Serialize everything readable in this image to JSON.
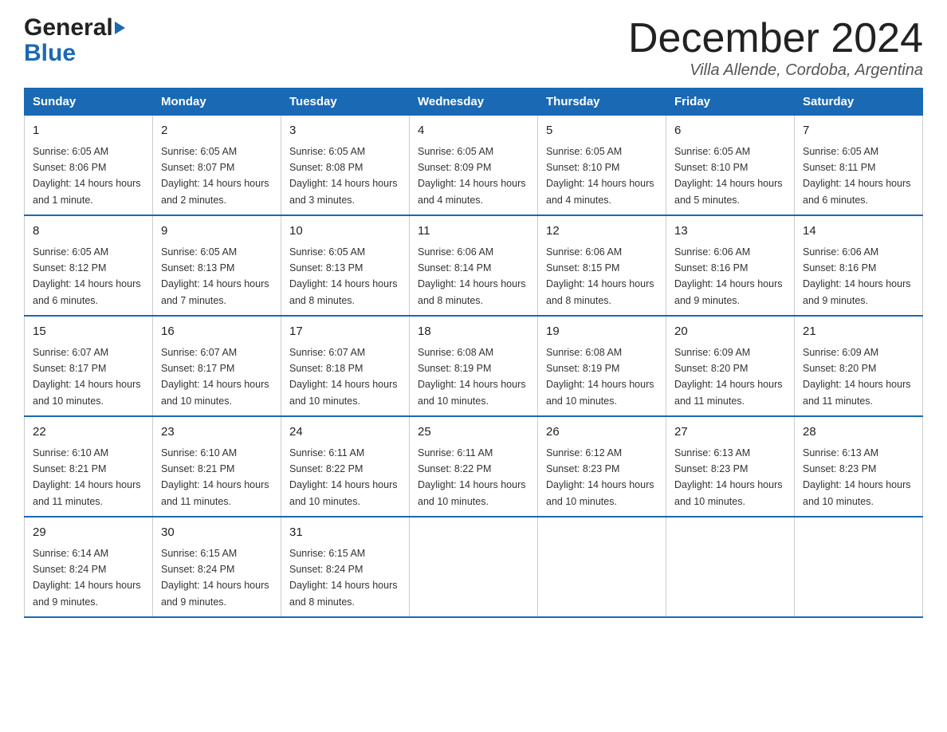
{
  "header": {
    "logo_general": "General",
    "logo_blue": "Blue",
    "title": "December 2024",
    "subtitle": "Villa Allende, Cordoba, Argentina"
  },
  "days_of_week": [
    "Sunday",
    "Monday",
    "Tuesday",
    "Wednesday",
    "Thursday",
    "Friday",
    "Saturday"
  ],
  "weeks": [
    [
      {
        "day": "1",
        "sunrise": "6:05 AM",
        "sunset": "8:06 PM",
        "daylight": "14 hours and 1 minute."
      },
      {
        "day": "2",
        "sunrise": "6:05 AM",
        "sunset": "8:07 PM",
        "daylight": "14 hours and 2 minutes."
      },
      {
        "day": "3",
        "sunrise": "6:05 AM",
        "sunset": "8:08 PM",
        "daylight": "14 hours and 3 minutes."
      },
      {
        "day": "4",
        "sunrise": "6:05 AM",
        "sunset": "8:09 PM",
        "daylight": "14 hours and 4 minutes."
      },
      {
        "day": "5",
        "sunrise": "6:05 AM",
        "sunset": "8:10 PM",
        "daylight": "14 hours and 4 minutes."
      },
      {
        "day": "6",
        "sunrise": "6:05 AM",
        "sunset": "8:10 PM",
        "daylight": "14 hours and 5 minutes."
      },
      {
        "day": "7",
        "sunrise": "6:05 AM",
        "sunset": "8:11 PM",
        "daylight": "14 hours and 6 minutes."
      }
    ],
    [
      {
        "day": "8",
        "sunrise": "6:05 AM",
        "sunset": "8:12 PM",
        "daylight": "14 hours and 6 minutes."
      },
      {
        "day": "9",
        "sunrise": "6:05 AM",
        "sunset": "8:13 PM",
        "daylight": "14 hours and 7 minutes."
      },
      {
        "day": "10",
        "sunrise": "6:05 AM",
        "sunset": "8:13 PM",
        "daylight": "14 hours and 8 minutes."
      },
      {
        "day": "11",
        "sunrise": "6:06 AM",
        "sunset": "8:14 PM",
        "daylight": "14 hours and 8 minutes."
      },
      {
        "day": "12",
        "sunrise": "6:06 AM",
        "sunset": "8:15 PM",
        "daylight": "14 hours and 8 minutes."
      },
      {
        "day": "13",
        "sunrise": "6:06 AM",
        "sunset": "8:16 PM",
        "daylight": "14 hours and 9 minutes."
      },
      {
        "day": "14",
        "sunrise": "6:06 AM",
        "sunset": "8:16 PM",
        "daylight": "14 hours and 9 minutes."
      }
    ],
    [
      {
        "day": "15",
        "sunrise": "6:07 AM",
        "sunset": "8:17 PM",
        "daylight": "14 hours and 10 minutes."
      },
      {
        "day": "16",
        "sunrise": "6:07 AM",
        "sunset": "8:17 PM",
        "daylight": "14 hours and 10 minutes."
      },
      {
        "day": "17",
        "sunrise": "6:07 AM",
        "sunset": "8:18 PM",
        "daylight": "14 hours and 10 minutes."
      },
      {
        "day": "18",
        "sunrise": "6:08 AM",
        "sunset": "8:19 PM",
        "daylight": "14 hours and 10 minutes."
      },
      {
        "day": "19",
        "sunrise": "6:08 AM",
        "sunset": "8:19 PM",
        "daylight": "14 hours and 10 minutes."
      },
      {
        "day": "20",
        "sunrise": "6:09 AM",
        "sunset": "8:20 PM",
        "daylight": "14 hours and 11 minutes."
      },
      {
        "day": "21",
        "sunrise": "6:09 AM",
        "sunset": "8:20 PM",
        "daylight": "14 hours and 11 minutes."
      }
    ],
    [
      {
        "day": "22",
        "sunrise": "6:10 AM",
        "sunset": "8:21 PM",
        "daylight": "14 hours and 11 minutes."
      },
      {
        "day": "23",
        "sunrise": "6:10 AM",
        "sunset": "8:21 PM",
        "daylight": "14 hours and 11 minutes."
      },
      {
        "day": "24",
        "sunrise": "6:11 AM",
        "sunset": "8:22 PM",
        "daylight": "14 hours and 10 minutes."
      },
      {
        "day": "25",
        "sunrise": "6:11 AM",
        "sunset": "8:22 PM",
        "daylight": "14 hours and 10 minutes."
      },
      {
        "day": "26",
        "sunrise": "6:12 AM",
        "sunset": "8:23 PM",
        "daylight": "14 hours and 10 minutes."
      },
      {
        "day": "27",
        "sunrise": "6:13 AM",
        "sunset": "8:23 PM",
        "daylight": "14 hours and 10 minutes."
      },
      {
        "day": "28",
        "sunrise": "6:13 AM",
        "sunset": "8:23 PM",
        "daylight": "14 hours and 10 minutes."
      }
    ],
    [
      {
        "day": "29",
        "sunrise": "6:14 AM",
        "sunset": "8:24 PM",
        "daylight": "14 hours and 9 minutes."
      },
      {
        "day": "30",
        "sunrise": "6:15 AM",
        "sunset": "8:24 PM",
        "daylight": "14 hours and 9 minutes."
      },
      {
        "day": "31",
        "sunrise": "6:15 AM",
        "sunset": "8:24 PM",
        "daylight": "14 hours and 8 minutes."
      },
      null,
      null,
      null,
      null
    ]
  ],
  "labels": {
    "sunrise": "Sunrise:",
    "sunset": "Sunset:",
    "daylight": "Daylight:"
  }
}
